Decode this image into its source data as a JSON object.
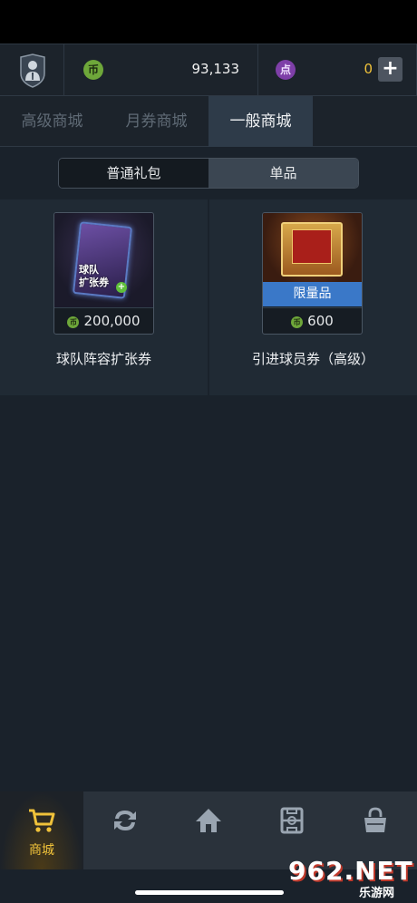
{
  "header": {
    "coin_icon": "币",
    "coin_amount": "93,133",
    "point_icon": "点",
    "point_amount": "0",
    "add_label": "+"
  },
  "shop_tabs": [
    {
      "label": "高级商城",
      "active": false
    },
    {
      "label": "月券商城",
      "active": false
    },
    {
      "label": "一般商城",
      "active": true
    }
  ],
  "segment": [
    {
      "label": "普通礼包",
      "active": false
    },
    {
      "label": "单品",
      "active": true
    }
  ],
  "products": [
    {
      "name": "球队阵容扩张券",
      "price": "200,000",
      "currency_icon": "币",
      "card_text_line1": "球队",
      "card_text_line2": "扩张券",
      "badge": ""
    },
    {
      "name": "引进球员券（高级）",
      "price": "600",
      "currency_icon": "币",
      "badge": "限量品"
    }
  ],
  "bottom_nav": [
    {
      "icon": "cart-icon",
      "label": "商城",
      "active": true
    },
    {
      "icon": "transfer-icon",
      "label": "",
      "active": false
    },
    {
      "icon": "home-icon",
      "label": "",
      "active": false
    },
    {
      "icon": "pitch-icon",
      "label": "",
      "active": false
    },
    {
      "icon": "bag-icon",
      "label": "",
      "active": false
    }
  ],
  "watermark": {
    "top": "962.NET",
    "bottom": "乐游网"
  },
  "colors": {
    "accent_gold": "#f0c23a",
    "limited_blue": "#3a78c8",
    "coin_green": "#6ea73a",
    "point_purple": "#7e3fa8"
  }
}
